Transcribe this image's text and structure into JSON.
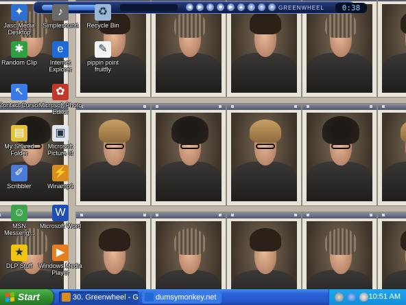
{
  "media_player": {
    "label": "GREENWHEEL",
    "time": "0:38",
    "controls": [
      "prev",
      "play",
      "pause",
      "stop",
      "next",
      "eject",
      "shuffle",
      "repeat",
      "volume",
      "eq"
    ]
  },
  "desktop_icons": [
    {
      "label": "Jasc Media Desktop",
      "icon": "media-desktop-icon",
      "color": "#2f6fd0"
    },
    {
      "label": "Simplesound",
      "icon": "sound-icon",
      "color": "#6a6a6a"
    },
    {
      "label": "Recycle Bin",
      "icon": "recycle-bin-icon",
      "color": "#9ab8d8"
    },
    {
      "label": "Random Clip",
      "icon": "random-clip-icon",
      "color": "#2ea043"
    },
    {
      "label": "Internet Explorer",
      "icon": "internet-explorer-icon",
      "color": "#1f6ad6"
    },
    {
      "label": "pippin point fruitfly",
      "icon": "document-icon",
      "color": "#f3f3f3"
    },
    {
      "label": "Contact Cursor",
      "icon": "cursor-icon",
      "color": "#3a7ae6"
    },
    {
      "label": "Microsoft Photo Editor",
      "icon": "photo-editor-icon",
      "color": "#c0392b"
    },
    {
      "label": "My Shared Folder",
      "icon": "shared-folder-icon",
      "color": "#e3c23c"
    },
    {
      "label": "Microsoft Picture It!",
      "icon": "picture-it-icon",
      "color": "#dfe6ef"
    },
    {
      "label": "Scribbler",
      "icon": "scribbler-icon",
      "color": "#4b7bd6"
    },
    {
      "label": "Winamp3",
      "icon": "winamp-icon",
      "color": "#d98c1f"
    },
    {
      "label": "MSN Messeng...",
      "icon": "msn-messenger-icon",
      "color": "#3fa34d"
    },
    {
      "label": "Microsoft Word",
      "icon": "word-icon",
      "color": "#1f4fb4"
    },
    {
      "label": "DLP Stuff",
      "icon": "star-icon",
      "color": "#f1c40f"
    },
    {
      "label": "Windows Media Player",
      "icon": "media-player-icon",
      "color": "#e67e22"
    }
  ],
  "taskbar": {
    "start_label": "Start",
    "tasks": [
      {
        "label": "30. Greenwheel - Gre...",
        "icon": "winamp-icon",
        "color": "#d98c1f"
      },
      {
        "label": "dumsymonkey.net",
        "icon": "internet-explorer-icon",
        "color": "#1f6ad6"
      }
    ],
    "clock": "10:51 AM"
  },
  "wallpaper_tiles": {
    "rows": [
      [
        "beanie",
        "dark",
        "beanie",
        "dark",
        "beanie",
        "dark"
      ],
      [
        "curly",
        "blond",
        "curly",
        "blond",
        "curly",
        "blond"
      ],
      [
        "beanie",
        "dark",
        "beanie",
        "dark",
        "beanie",
        "dark"
      ]
    ]
  }
}
